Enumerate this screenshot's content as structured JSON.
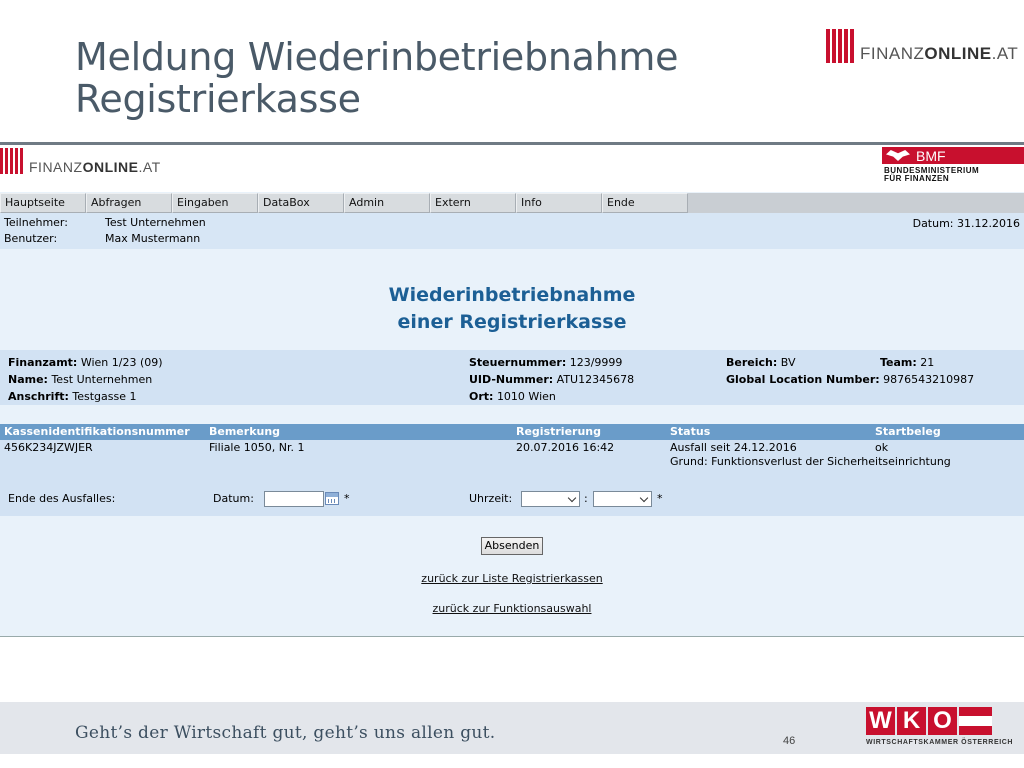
{
  "slide": {
    "title_line1": "Meldung Wiederinbetriebnahme",
    "title_line2": "Registrierkasse",
    "logo_text_light": "FINANZ",
    "logo_text_bold": "ONLINE",
    "logo_text_suffix": ".AT",
    "slogan": "Geht’s der Wirtschaft gut, geht’s uns allen gut.",
    "page_number": "46",
    "wko": {
      "letters": [
        "W",
        "K",
        "O"
      ],
      "subtitle": "WIRTSCHAFTSKAMMER ÖSTERREICH"
    }
  },
  "app": {
    "logo_text_light": "FINANZ",
    "logo_text_bold": "ONLINE",
    "logo_text_suffix": ".AT",
    "bmf": {
      "short": "BMF",
      "line1": "BUNDESMINISTERIUM",
      "line2": "FÜR FINANZEN"
    },
    "menu": [
      "Hauptseite",
      "Abfragen",
      "Eingaben",
      "DataBox",
      "Admin",
      "Extern",
      "Info",
      "Ende"
    ],
    "user": {
      "participant_label": "Teilnehmer:",
      "participant_value": "Test Unternehmen",
      "user_label": "Benutzer:",
      "user_value": "Max Mustermann",
      "date_text": "Datum: 31.12.2016"
    },
    "form_title_line1": "Wiederinbetriebnahme",
    "form_title_line2": "einer Registrierkasse",
    "info": {
      "finanzamt_label": "Finanzamt:",
      "finanzamt_value": "Wien 1/23  (09)",
      "name_label": "Name:",
      "name_value": "Test Unternehmen",
      "anschrift_label": "Anschrift:",
      "anschrift_value": "Testgasse 1",
      "steuernummer_label": "Steuernummer:",
      "steuernummer_value": "123/9999",
      "uid_label": "UID-Nummer:",
      "uid_value": "ATU12345678",
      "ort_label": "Ort:",
      "ort_value": "1010 Wien",
      "bereich_label": "Bereich:",
      "bereich_value": "BV",
      "team_label": "Team:",
      "team_value": "21",
      "gln_label": "Global Location Number:",
      "gln_value": "9876543210987"
    },
    "table": {
      "headers": [
        "Kassenidentifikationsnummer",
        "Bemerkung",
        "Registrierung",
        "Status",
        "Startbeleg"
      ],
      "row": {
        "id": "456K234JZWJER",
        "remark": "Filiale 1050, Nr. 1",
        "registered": "20.07.2016 16:42",
        "status_line1": "Ausfall seit 24.12.2016",
        "status_line2": "Grund: Funktionsverlust der Sicherheitseinrichtung",
        "startbeleg": "ok"
      }
    },
    "ende": {
      "label": "Ende des Ausfalles:",
      "date_label": "Datum:",
      "date_value": "",
      "required_mark": "*",
      "time_label": "Uhrzeit:",
      "time_separator": ":",
      "hour_value": "",
      "minute_value": ""
    },
    "submit_label": "Absenden",
    "link_back_list": "zurück zur Liste Registrierkassen",
    "link_back_functions": "zurück zur Funktionsauswahl"
  }
}
